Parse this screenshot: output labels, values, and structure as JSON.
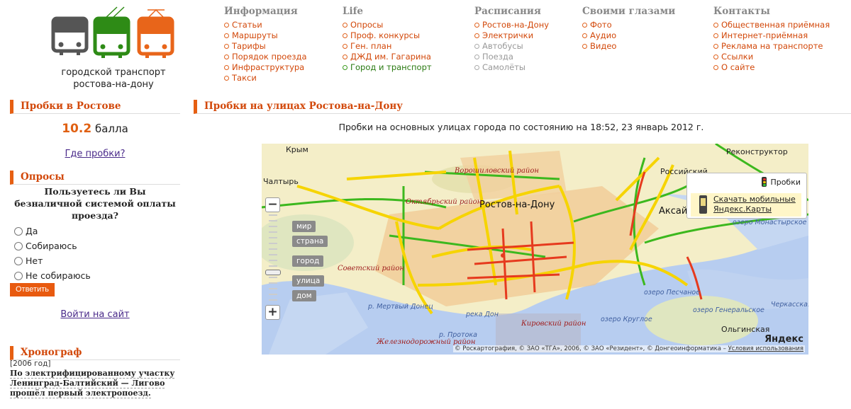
{
  "logo": {
    "caption_line1": "городской транспорт",
    "caption_line2": "ростова-на-дону",
    "colors": {
      "bus": "#555555",
      "trolleybus": "#2e8b16",
      "tram": "#e8651a"
    }
  },
  "nav": [
    {
      "title": "Информация",
      "items": [
        "Статьи",
        "Маршруты",
        "Тарифы",
        "Порядок проезда",
        "Инфраструктура",
        "Такси"
      ]
    },
    {
      "title": "Life",
      "items": [
        "Опросы",
        "Проф. конкурсы",
        "Ген. план",
        "ДЖД им. Гагарина",
        "Город и транспорт"
      ]
    },
    {
      "title": "Расписания",
      "items": [
        "Ростов-на-Дону",
        "Электрички",
        "Автобусы",
        "Поезда",
        "Самолёты"
      ]
    },
    {
      "title": "Своими глазами",
      "items": [
        "Фото",
        "Аудио",
        "Видео"
      ]
    },
    {
      "title": "Контакты",
      "items": [
        "Общественная приёмная",
        "Интернет-приёмная",
        "Реклама на транспорте",
        "Ссылки",
        "О сайте"
      ]
    }
  ],
  "sidebar": {
    "traffic_title": "Пробки в Ростове",
    "traffic_score": "10.2",
    "traffic_unit": "балла",
    "where_link": "Где пробки?",
    "poll_title": "Опросы",
    "poll_question": "Пользуетесь ли Вы безналичной системой оплаты проезда?",
    "poll_options": [
      "Да",
      "Собираюсь",
      "Нет",
      "Не собираюсь"
    ],
    "vote_button": "Ответить",
    "login_link": "Войти на сайт",
    "chrono_title": "Хронограф",
    "chrono_year": "[2006 год]",
    "chrono_text": "По электрифицированному участку Ленинград-Балтийский — Лигово прошёл первый электропоезд."
  },
  "main": {
    "title": "Пробки на улицах Ростова-на-Дону",
    "subtitle": "Пробки на основных улицах города по состоянию на 18:52, 23 январь 2012 г."
  },
  "map": {
    "zoom_labels": [
      "мир",
      "страна",
      "город",
      "улица",
      "дом"
    ],
    "zoom_in": "+",
    "zoom_out": "−",
    "traffic_toggle": "Пробки",
    "promo_line1": "Скачать мобильные",
    "promo_line2": "Яндекс.Карты",
    "logo": "Яндекс",
    "copyright": "© Роскартография, © ЗАО «ТГА», 2006, © ЗАО «Резидент», © Донгеоинформатика –",
    "terms_link": "Условия использования",
    "labels": {
      "krym": "Крым",
      "chaltyr": "Чалтырь",
      "reconstructor": "Реконструктор",
      "rossiysky": "Российский",
      "aksay": "Аксай",
      "rostov": "Ростов-на-Дону",
      "voroshil": "Ворошиловский район",
      "oktyabr": "Октябрьский район",
      "sovet": "Советский район",
      "kirov": "Кировский район",
      "zhelezn": "Железнодорожный район",
      "monast": "озеро Монастырское",
      "peschanoe": "озеро Песчаное",
      "general": "озеро Генеральское",
      "krugloe": "озеро Круглое",
      "olginskaya": "Ольгинская",
      "cherkasskaya": "Черкасская",
      "reka_don": "река Дон",
      "protoka": "р. Протока",
      "mertvy": "р. Мертвый Донец"
    }
  }
}
